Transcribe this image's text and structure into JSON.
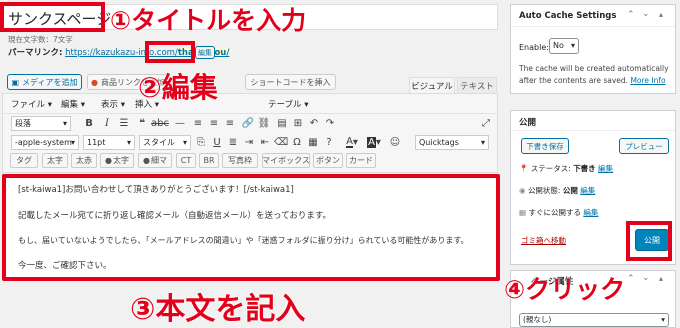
{
  "title_input": {
    "value": "サンクスページ"
  },
  "char_count": "現在文字数：7文字",
  "permalink": {
    "label": "パーマリンク:",
    "url_prefix": "https://kazukazu-info.com/",
    "slug": "thank-you/",
    "edit_label": "編集"
  },
  "media_buttons": {
    "add_media": "メディアを追加",
    "product_link": "商品リンクを追加",
    "shortcode": "ショートコードを挿入"
  },
  "editor_tabs": {
    "visual": "ビジュアル",
    "text": "テキスト"
  },
  "menubar": [
    "ファイル ▾",
    "編集 ▾",
    "表示 ▾",
    "挿入 ▾",
    "テーブル ▾"
  ],
  "toolbar": {
    "format": "段落",
    "font": "-apple-system",
    "size": "11pt",
    "style": "スタイル",
    "quicktags": "Quicktags"
  },
  "quicktag_buttons": [
    "タグ",
    "太字",
    "太赤",
    "太字",
    "細マ",
    "CT",
    "BR",
    "写真枠",
    "マイボックス",
    "ボタン",
    "カード"
  ],
  "content": [
    "[st-kaiwa1]お問い合わせして頂きありがとうございます！[/st-kaiwa1]",
    "記載したメール宛てに折り返し確認メール（自動返信メール）を送っております。",
    "もし、届いていないようでしたら、「メールアドレスの間違い」や「迷惑フォルダに振り分け」られている可能性があります。",
    "今一度、ご確認下さい。"
  ],
  "auto_cache": {
    "title": "Auto Cache Settings",
    "enable_label": "Enable:",
    "enable_value": "No",
    "description_line1": "The cache will be created automatically",
    "description_line2": "after the contents are saved.",
    "more_info": "More Info"
  },
  "publish": {
    "title": "公開",
    "save_draft": "下書き保存",
    "preview": "プレビュー",
    "status_label": "ステータス:",
    "status_value": "下書き",
    "status_edit": "編集",
    "visibility_label": "公開状態:",
    "visibility_value": "公開",
    "visibility_edit": "編集",
    "schedule_label": "すぐに公開する",
    "schedule_edit": "編集",
    "trash": "ゴミ箱へ移動",
    "publish_button": "公開"
  },
  "attributes": {
    "title": "ページ属性",
    "parent_select": "(親なし)"
  },
  "annotations": {
    "step1": "①タイトルを入力",
    "step2": "②編集",
    "step3": "③本文を記入",
    "step4": "④クリック"
  }
}
